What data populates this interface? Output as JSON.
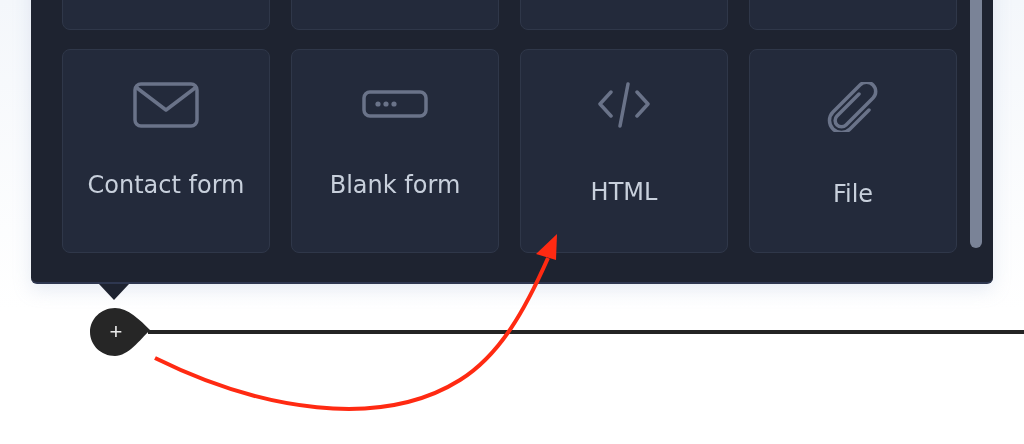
{
  "tiles": [
    {
      "kind": "cutoff"
    },
    {
      "kind": "cutoff"
    },
    {
      "kind": "cutoff"
    },
    {
      "kind": "cutoff"
    },
    {
      "kind": "mail",
      "label": "Contact form"
    },
    {
      "kind": "input",
      "label": "Blank form"
    },
    {
      "kind": "code",
      "label": "HTML"
    },
    {
      "kind": "clip",
      "label": "File"
    }
  ],
  "add_button": {
    "label": "+"
  }
}
